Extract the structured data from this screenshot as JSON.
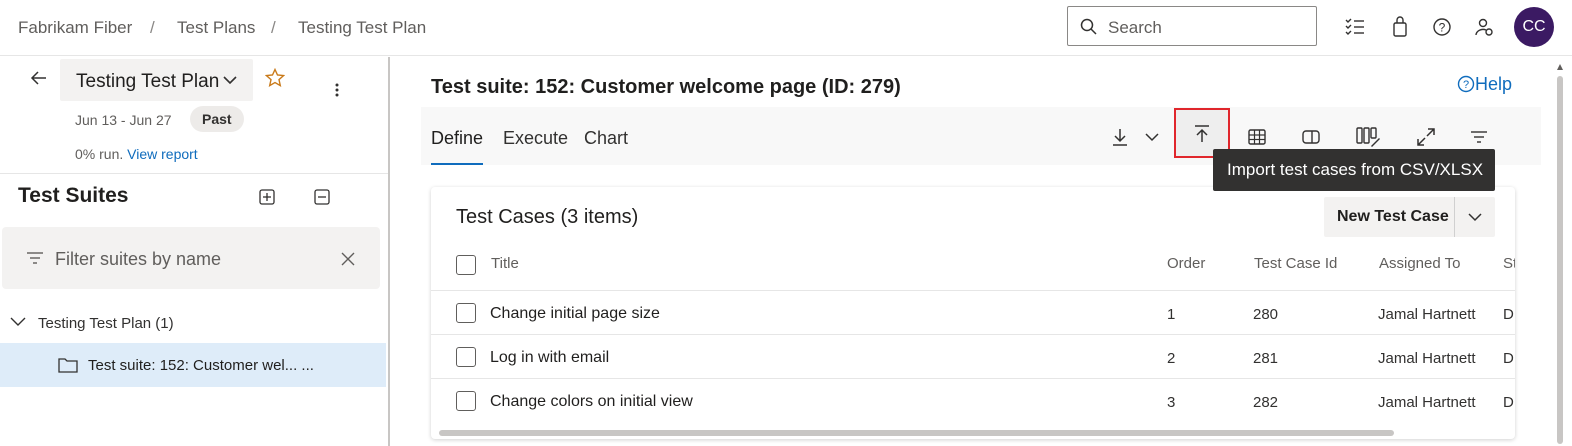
{
  "breadcrumb": {
    "org": "Fabrikam Fiber",
    "section": "Test Plans",
    "page": "Testing Test Plan",
    "separator": "/"
  },
  "search": {
    "placeholder": "Search"
  },
  "user": {
    "initials": "CC",
    "avatar_color": "#3b1a63"
  },
  "plan": {
    "name": "Testing Test Plan",
    "dates": "Jun 13 - Jun 27",
    "badge": "Past",
    "run_text": "0% run.",
    "report_link": "View report"
  },
  "suites": {
    "title": "Test Suites",
    "filter_placeholder": "Filter suites by name",
    "root": "Testing Test Plan (1)",
    "selected": "Test suite: 152: Customer wel... ..."
  },
  "main": {
    "title": "Test suite: 152: Customer welcome page (ID: 279)",
    "help": "Help",
    "tabs": [
      "Define",
      "Execute",
      "Chart"
    ],
    "tooltip": "Import test cases from CSV/XLSX"
  },
  "grid": {
    "title": "Test Cases (3 items)",
    "new_button": "New Test Case",
    "columns": [
      "Title",
      "Order",
      "Test Case Id",
      "Assigned To",
      "St"
    ],
    "rows": [
      {
        "title": "Change initial page size",
        "order": "1",
        "id": "280",
        "assigned": "Jamal Hartnett",
        "state": "D"
      },
      {
        "title": "Log in with email",
        "order": "2",
        "id": "281",
        "assigned": "Jamal Hartnett",
        "state": "D"
      },
      {
        "title": "Change colors on initial view",
        "order": "3",
        "id": "282",
        "assigned": "Jamal Hartnett",
        "state": "D"
      }
    ]
  },
  "colors": {
    "accent": "#0f6cbd",
    "highlight": "#e0262c",
    "selection": "#deecf9"
  }
}
